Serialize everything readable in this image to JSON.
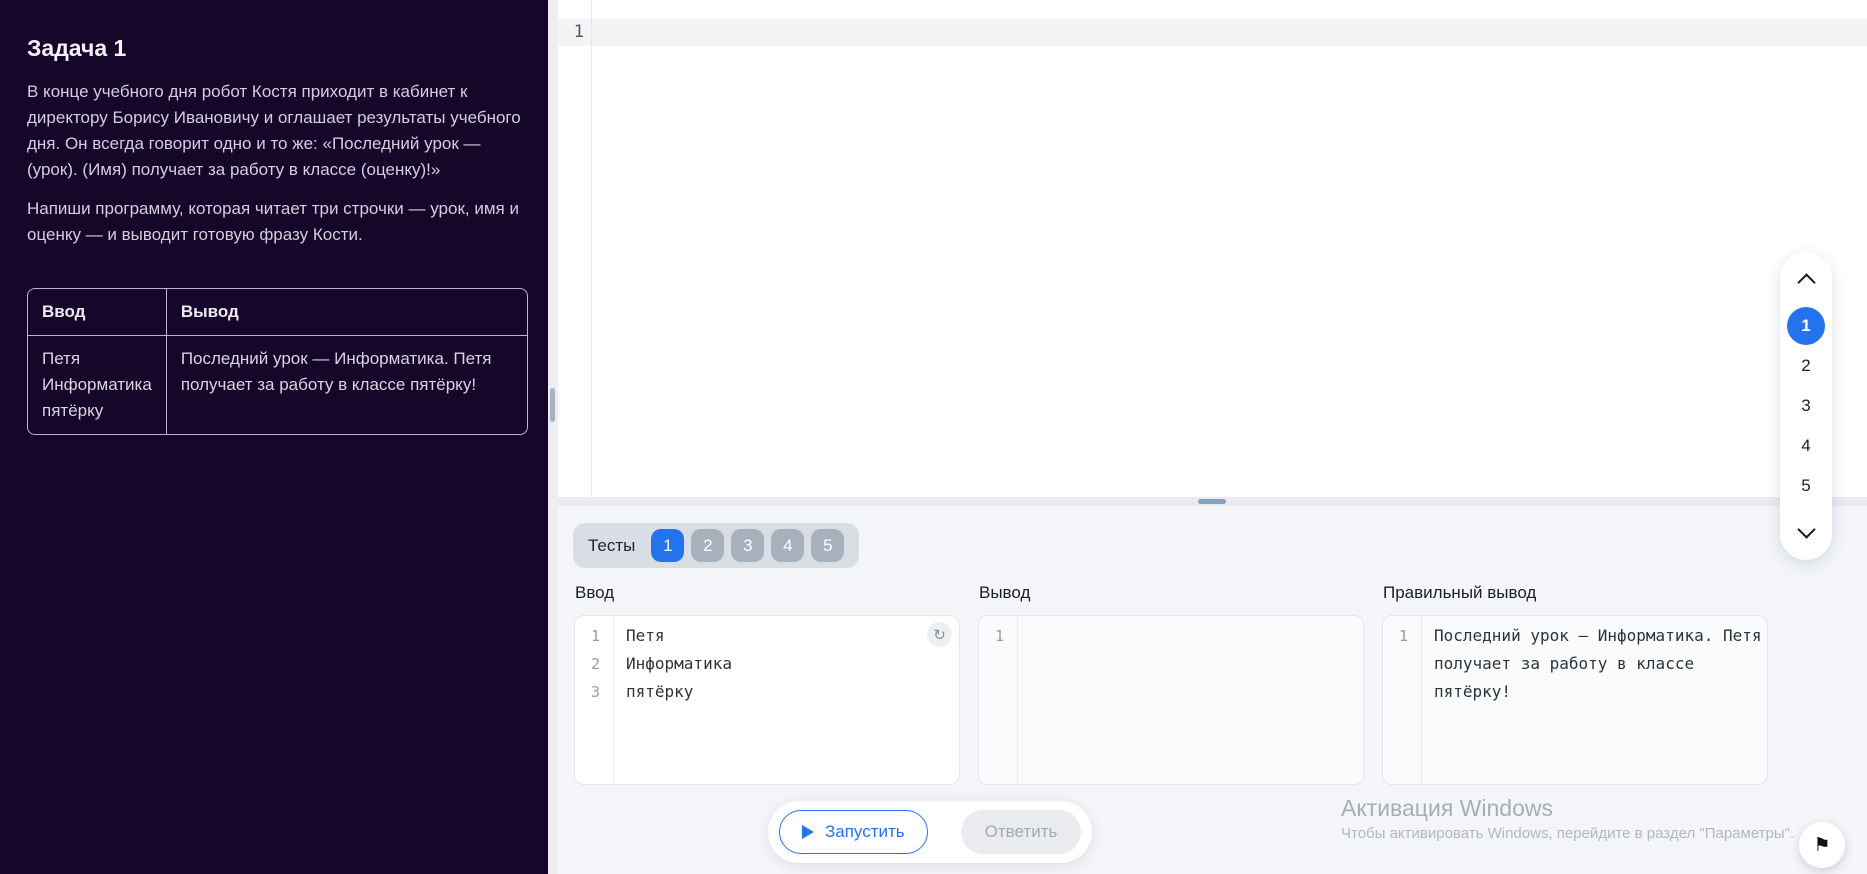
{
  "colors": {
    "accent": "#2374ec",
    "sidebar_bg": "#160629"
  },
  "icons": {
    "refresh": "↻",
    "flag": "⚑"
  },
  "sidebar": {
    "title": "Задача 1",
    "paragraphs": [
      "В конце учебного дня робот Костя приходит в кабинет к директору Борису Ивановичу и оглашает результаты учебного дня. Он всегда говорит одно и то же: «Последний урок — (урок). (Имя) получает за работу в классе (оценку)!»",
      "Напиши программу, которая читает три строчки — урок, имя и оценку — и выводит готовую фразу Кости."
    ],
    "table": {
      "headers": [
        "Ввод",
        "Вывод"
      ],
      "rows": [
        {
          "input": "Петя\nИнформатика\nпятёрку",
          "output": "Последний урок — Информатика. Петя получает за работу в классе пятёрку!"
        }
      ]
    }
  },
  "editor": {
    "line_number": "1",
    "code": ""
  },
  "tests": {
    "label": "Тесты",
    "tabs": [
      {
        "label": "1",
        "active": true
      },
      {
        "label": "2",
        "active": false
      },
      {
        "label": "3",
        "active": false
      },
      {
        "label": "4",
        "active": false
      },
      {
        "label": "5",
        "active": false
      }
    ],
    "panels": {
      "input": {
        "label": "Ввод",
        "lines": [
          "Петя",
          "Информатика",
          "пятёрку"
        ]
      },
      "output": {
        "label": "Вывод",
        "lines": [
          ""
        ]
      },
      "expected": {
        "label": "Правильный вывод",
        "lines": [
          "Последний урок — Информатика. Петя получает за работу в классе пятёрку!"
        ]
      }
    },
    "buttons": {
      "run": "Запустить",
      "answer": "Ответить"
    }
  },
  "nav": {
    "items": [
      "1",
      "2",
      "3",
      "4",
      "5"
    ],
    "active": "1"
  },
  "watermark": {
    "title": "Активация Windows",
    "subtitle": "Чтобы активировать Windows, перейдите в раздел \"Параметры\"."
  }
}
